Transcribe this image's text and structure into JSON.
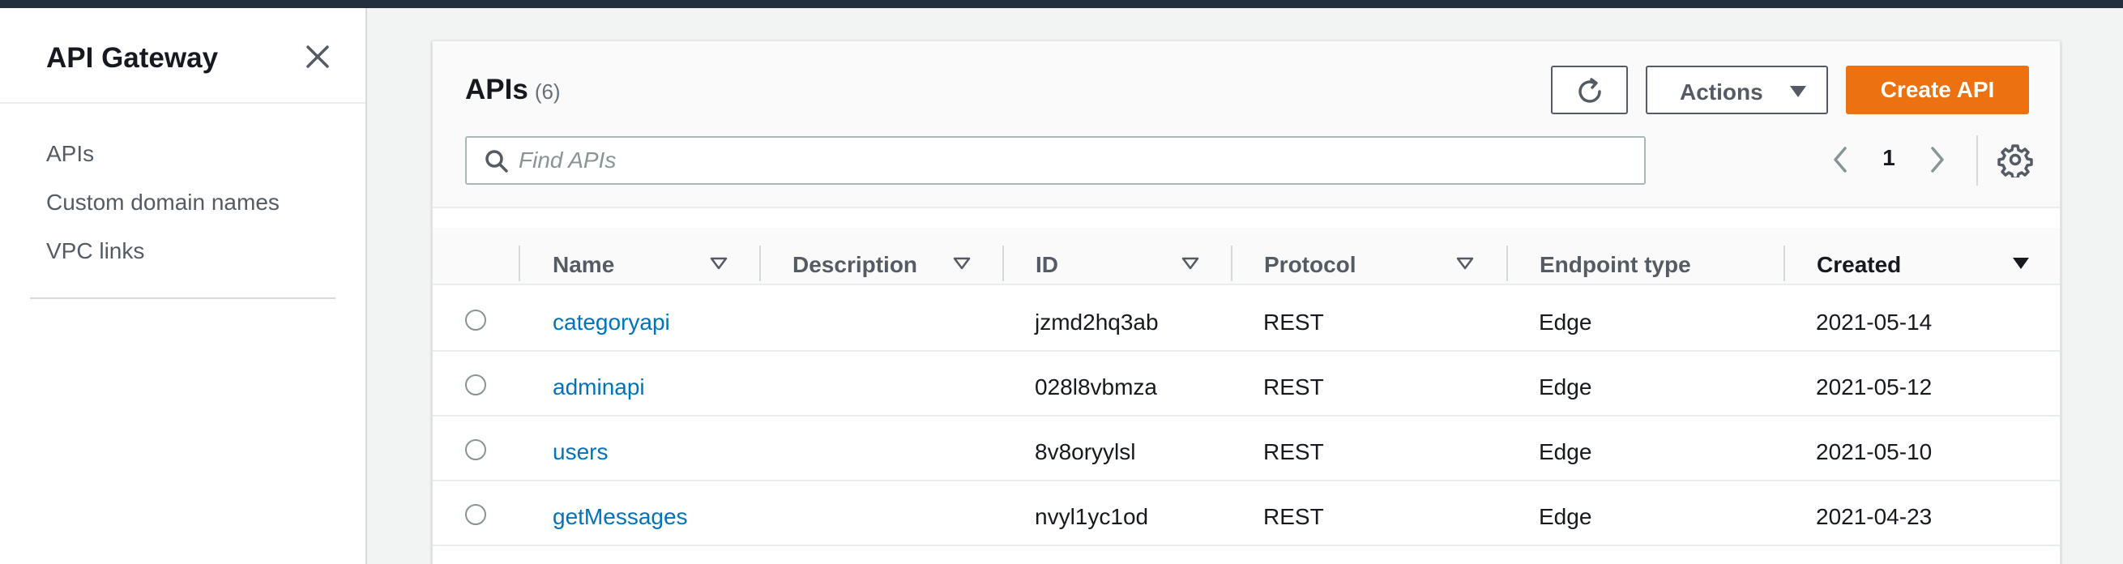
{
  "sidebar": {
    "title": "API Gateway",
    "items": [
      {
        "label": "APIs"
      },
      {
        "label": "Custom domain names"
      },
      {
        "label": "VPC links"
      }
    ]
  },
  "panel": {
    "title": "APIs",
    "count": "(6)",
    "actions_label": "Actions",
    "create_label": "Create API",
    "search": {
      "placeholder": "Find APIs",
      "value": ""
    },
    "page": "1"
  },
  "table": {
    "columns": [
      "Name",
      "Description",
      "ID",
      "Protocol",
      "Endpoint type",
      "Created"
    ],
    "rows": [
      {
        "name": "categoryapi",
        "description": "",
        "id": "jzmd2hq3ab",
        "protocol": "REST",
        "endpoint": "Edge",
        "created": "2021-05-14"
      },
      {
        "name": "adminapi",
        "description": "",
        "id": "028l8vbmza",
        "protocol": "REST",
        "endpoint": "Edge",
        "created": "2021-05-12"
      },
      {
        "name": "users",
        "description": "",
        "id": "8v8oryylsl",
        "protocol": "REST",
        "endpoint": "Edge",
        "created": "2021-05-10"
      },
      {
        "name": "getMessages",
        "description": "",
        "id": "nvyl1yc1od",
        "protocol": "REST",
        "endpoint": "Edge",
        "created": "2021-04-23"
      }
    ]
  },
  "colors": {
    "accent": "#ec7211",
    "link": "#0073bb",
    "topbar": "#232f3e"
  }
}
